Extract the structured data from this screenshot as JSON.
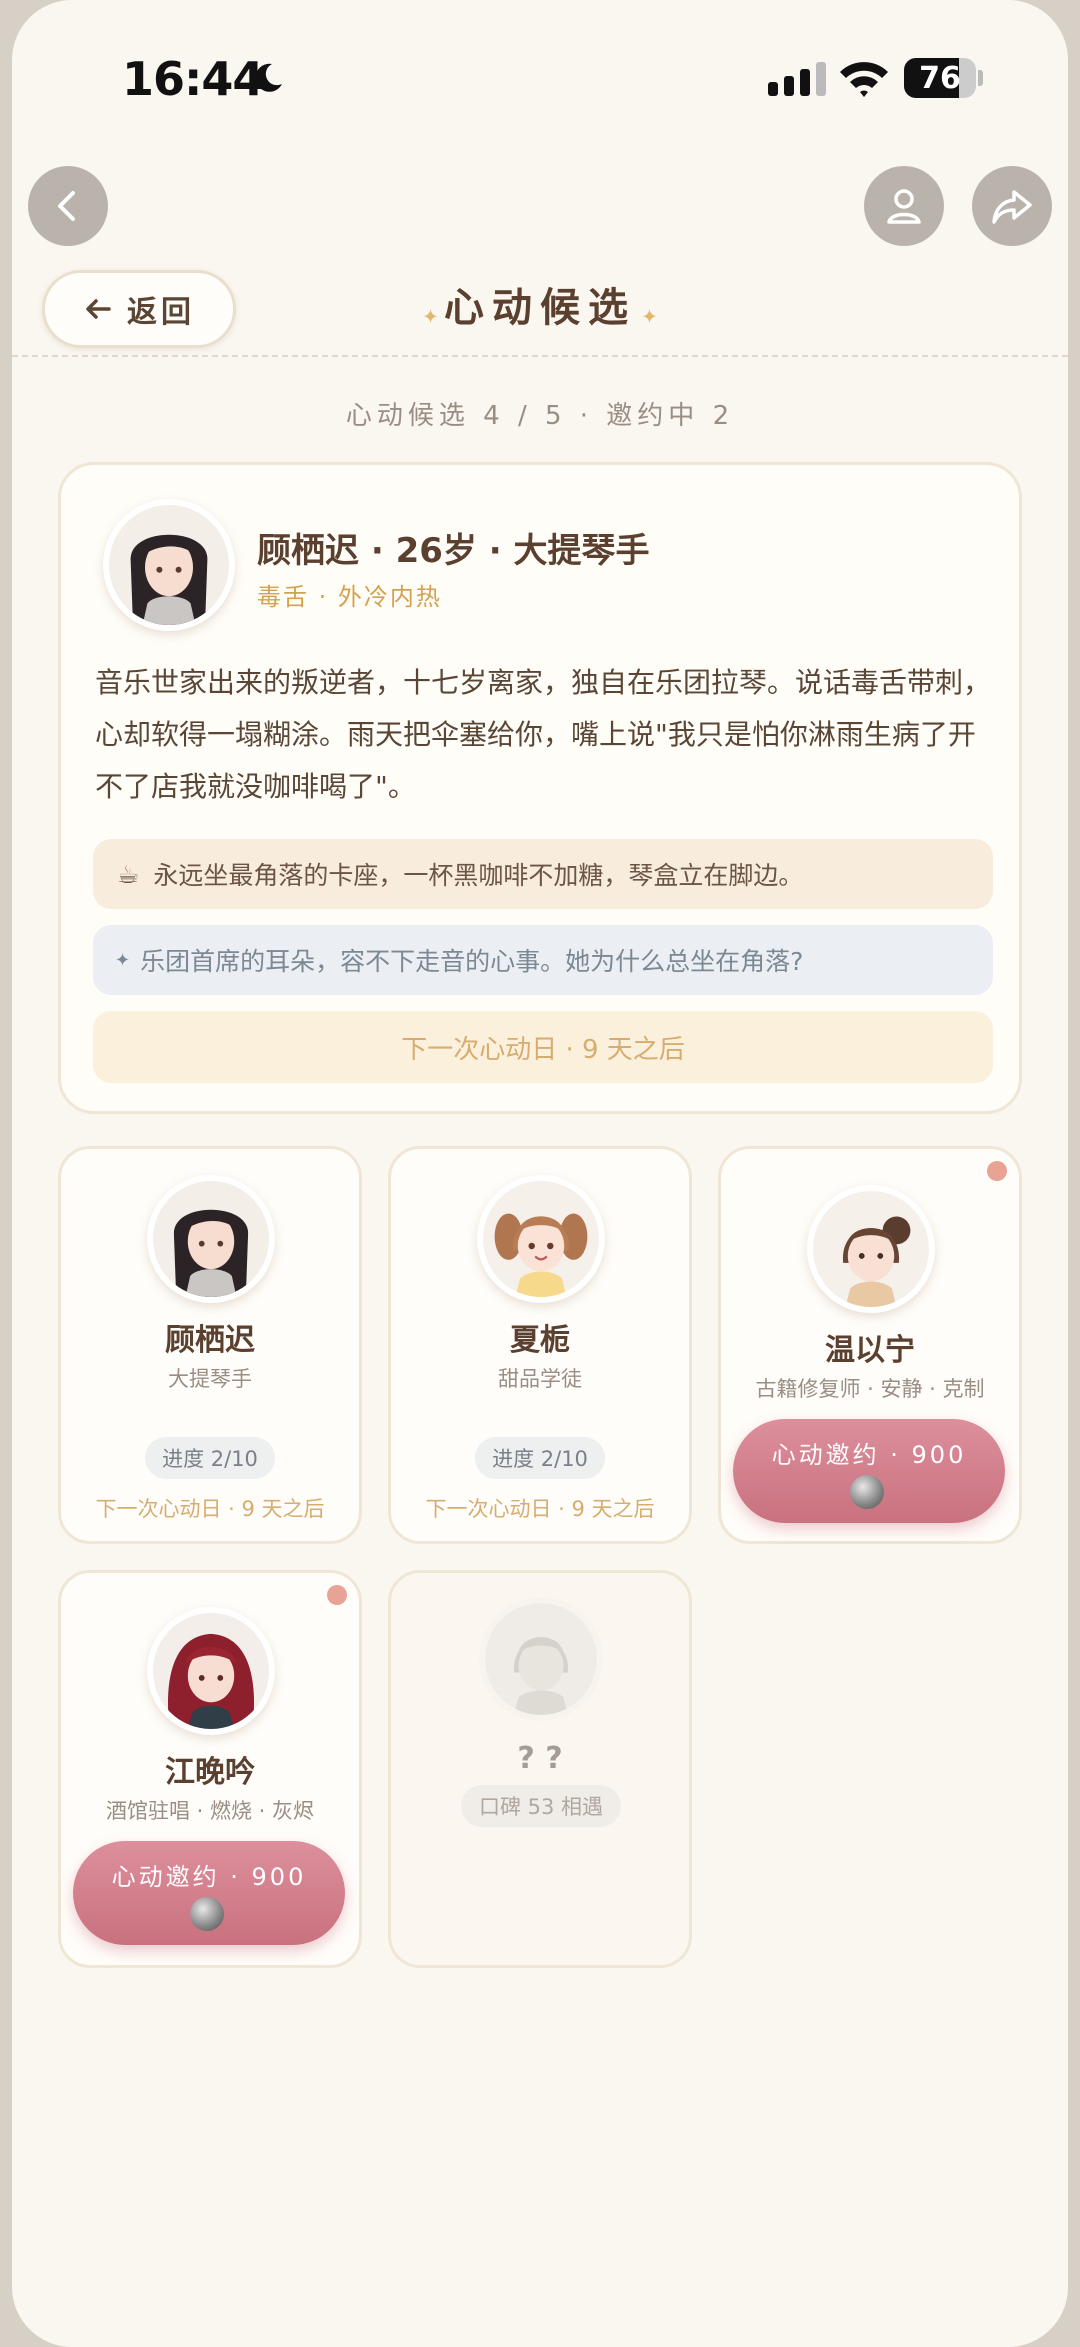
{
  "status_bar": {
    "time": "16:44",
    "battery": "76",
    "battery_level": 0.76
  },
  "header": {
    "back_label": "返回",
    "title": "心动候选",
    "summary": "心动候选 4 / 5 · 邀约中 2"
  },
  "featured": {
    "name_line": "顾栖迟 · 26岁 · 大提琴手",
    "tags": "毒舌 · 外冷内热",
    "description": "音乐世家出来的叛逆者，十七岁离家，独自在乐团拉琴。说话毒舌带刺，心却软得一塌糊涂。雨天把伞塞给你，嘴上说\"我只是怕你淋雨生病了开不了店我就没咖啡喝了\"。",
    "coffee_icon": "☕",
    "coffee_note": "永远坐最角落的卡座，一杯黑咖啡不加糖，琴盒立在脚边。",
    "hint_icon": "✦",
    "hint": "乐团首席的耳朵，容不下走音的心事。她为什么总坐在角落?",
    "next_date": "下一次心动日 · 9 天之后"
  },
  "candidates": [
    {
      "name": "顾栖迟",
      "role": "大提琴手",
      "progress": "进度 2/10",
      "next": "下一次心动日 · 9 天之后"
    },
    {
      "name": "夏栀",
      "role": "甜品学徒",
      "progress": "进度 2/10",
      "next": "下一次心动日 · 9 天之后"
    },
    {
      "name": "温以宁",
      "role": "古籍修复师 · 安静 · 克制",
      "invite": "心动邀约 · 900"
    },
    {
      "name": "江晚吟",
      "role": "酒馆驻唱 · 燃烧 · 灰烬",
      "invite": "心动邀约 · 900"
    },
    {
      "name": "? ?",
      "reputation": "口碑 53 相遇"
    }
  ],
  "colors": {
    "accent_pink": "#d4808e",
    "gold": "#d4a24f",
    "background": "#faf6f0"
  }
}
